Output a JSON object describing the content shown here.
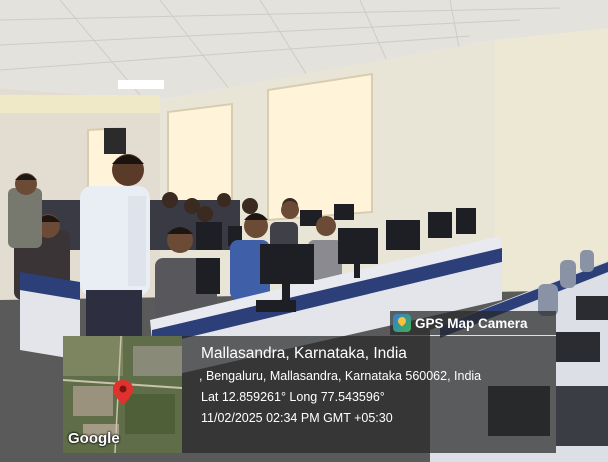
{
  "stamp": {
    "app_name": "GPS Map Camera",
    "location_title": "Mallasandra, Karnataka, India",
    "address": ", Bengaluru, Mallasandra, Karnataka 560062, India",
    "coordinates": "Lat 12.859261° Long 77.543596°",
    "datetime": "11/02/2025 02:34 PM GMT +05:30",
    "map_attribution": "Google"
  },
  "colors": {
    "wall": "#e9e5d6",
    "desk_panel": "#e8eaf0",
    "desk_stripe": "#2c3f78",
    "overlay": "#282828",
    "pin": "#e0322c"
  },
  "icons": [
    "gps-map-camera-icon",
    "map-pin-icon"
  ]
}
